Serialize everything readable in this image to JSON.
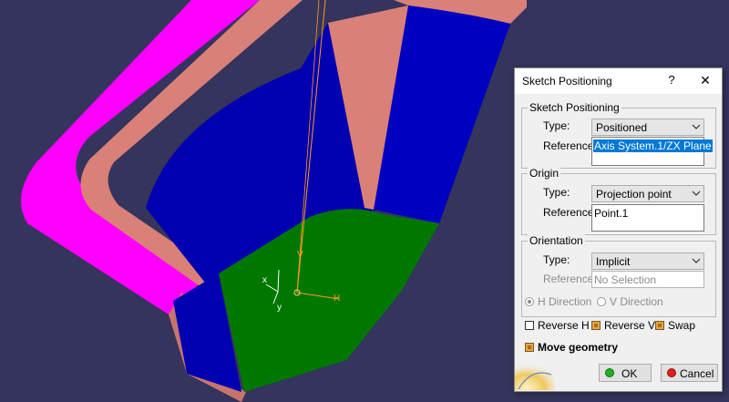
{
  "dialog": {
    "title": "Sketch Positioning",
    "help_glyph": "?",
    "close_glyph": "✕",
    "sketch_positioning": {
      "group_label": "Sketch Positioning",
      "type_label": "Type:",
      "type_value": "Positioned",
      "reference_label": "Reference:",
      "reference_value": "Axis System.1/ZX Plane"
    },
    "origin": {
      "group_label": "Origin",
      "type_label": "Type:",
      "type_value": "Projection point",
      "reference_label": "Reference:",
      "reference_value": "Point.1"
    },
    "orientation": {
      "group_label": "Orientation",
      "type_label": "Type:",
      "type_value": "Implicit",
      "reference_label": "Reference:",
      "reference_value": "No Selection",
      "h_direction_label": "H Direction",
      "v_direction_label": "V Direction",
      "h_direction_selected": true
    },
    "options": {
      "reverse_h_label": "Reverse H",
      "reverse_h_checked": false,
      "reverse_v_label": "Reverse V",
      "reverse_v_checked": true,
      "swap_label": "Swap",
      "swap_checked": true,
      "move_geometry_label": "Move geometry",
      "move_geometry_checked": true
    },
    "buttons": {
      "ok_label": "OK",
      "cancel_label": "Cancel"
    }
  },
  "viewport": {
    "axis_labels": {
      "h": "H",
      "v": "V",
      "x": "x",
      "y": "y"
    }
  },
  "colors": {
    "background": "#34345c",
    "magenta_face": "#ff00ff",
    "salmon_face": "#d9837d",
    "blue_face": "#0000b8",
    "green_face": "#007800",
    "sketch_axis": "#ff8c00",
    "ok_icon": "#22b022",
    "cancel_icon": "#e02020"
  }
}
